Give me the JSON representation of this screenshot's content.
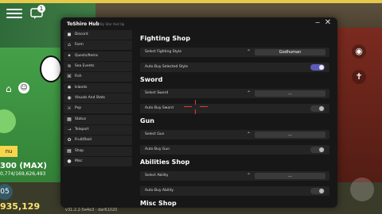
{
  "window": {
    "title": "ToShiro Hub",
    "subtitle": "By Star And Up",
    "minimize_icon": "−",
    "close_icon": "✕"
  },
  "sidebar": [
    {
      "icon": "discord-icon",
      "glyph": "◼",
      "label": "Discord"
    },
    {
      "icon": "farm-icon",
      "glyph": "⌂",
      "label": "Farm"
    },
    {
      "icon": "quests-icon",
      "glyph": "✦",
      "label": "Quests/Items"
    },
    {
      "icon": "sea-events-icon",
      "glyph": "≋",
      "label": "Sea Events"
    },
    {
      "icon": "fish-icon",
      "glyph": "⌘",
      "label": "Fish"
    },
    {
      "icon": "islands-icon",
      "glyph": "✱",
      "label": "Islands"
    },
    {
      "icon": "visuals-icon",
      "glyph": "◉",
      "label": "Visuals And Stats"
    },
    {
      "icon": "pvp-icon",
      "glyph": "⚔",
      "label": "Pvp"
    },
    {
      "icon": "status-icon",
      "glyph": "▦",
      "label": "Status"
    },
    {
      "icon": "teleport-icon",
      "glyph": "⇢",
      "label": "Teleport"
    },
    {
      "icon": "fruit-raid-icon",
      "glyph": "✿",
      "label": "Fruit/Raid"
    },
    {
      "icon": "shop-icon",
      "glyph": "▤",
      "label": "Shop"
    },
    {
      "icon": "misc-icon",
      "glyph": "●",
      "label": "Misc"
    }
  ],
  "content": {
    "fighting_shop": {
      "title": "Fighting Shop",
      "select_label": "Select Fighting Style",
      "select_value": "Godhuman",
      "auto_label": "Auto Buy Selected Style"
    },
    "sword": {
      "title": "Sword",
      "select_label": "Select Sword",
      "select_value": "...",
      "auto_label": "Auto Buy Sword"
    },
    "gun": {
      "title": "Gun",
      "select_label": "Select Gun",
      "select_value": "...",
      "auto_label": "Auto Buy Gun"
    },
    "abilities_shop": {
      "title": "Abilities Shop",
      "select_label": "Select Ability",
      "select_value": "...",
      "auto_label": "Auto Buy Ability"
    },
    "misc_shop": {
      "title": "Misc Shop"
    }
  },
  "hud": {
    "badge": "1",
    "level": "nu",
    "hp": "300 (MAX)",
    "exp": "0,774/169,626,493",
    "skill": "05",
    "money": "935,129",
    "version": "v31.2.2-5e4e3 · dar61020"
  }
}
